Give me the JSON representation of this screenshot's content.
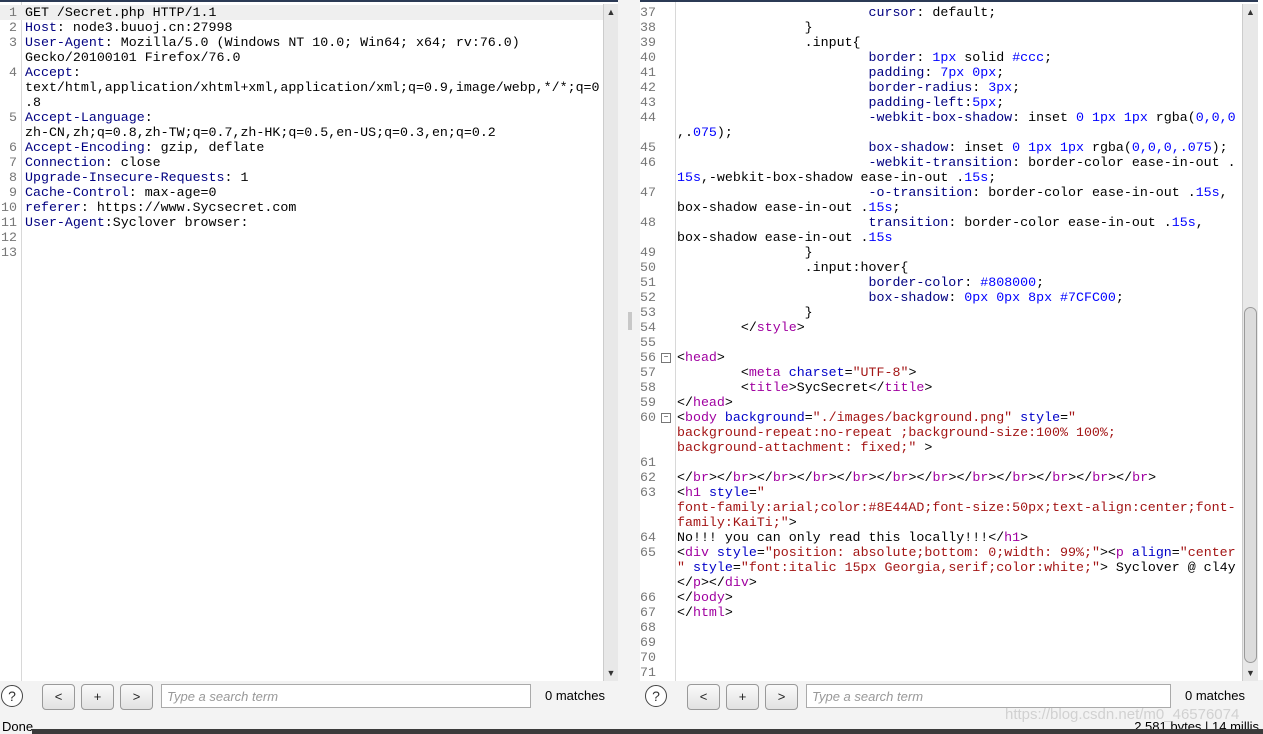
{
  "request": {
    "rows": [
      {
        "n": "1",
        "hl": true,
        "seg": [
          [
            "",
            "GET /Secret.php HTTP/1.1"
          ]
        ]
      },
      {
        "n": "2",
        "seg": [
          [
            "h",
            "Host"
          ],
          [
            "",
            ": node3.buuoj.cn:27998"
          ]
        ]
      },
      {
        "n": "3",
        "seg": [
          [
            "h",
            "User-Agent"
          ],
          [
            "",
            ": Mozilla/5.0 (Windows NT 10.0; Win64; x64; rv:76.0)"
          ]
        ]
      },
      {
        "n": "",
        "seg": [
          [
            "",
            "Gecko/20100101 Firefox/76.0"
          ]
        ]
      },
      {
        "n": "4",
        "seg": [
          [
            "h",
            "Accept"
          ],
          [
            "",
            ":"
          ]
        ]
      },
      {
        "n": "",
        "seg": [
          [
            "",
            "text/html,application/xhtml+xml,application/xml;q=0.9,image/webp,*/*;q=0"
          ]
        ]
      },
      {
        "n": "",
        "seg": [
          [
            "",
            ".8"
          ]
        ]
      },
      {
        "n": "5",
        "seg": [
          [
            "h",
            "Accept-Language"
          ],
          [
            "",
            ":"
          ]
        ]
      },
      {
        "n": "",
        "seg": [
          [
            "",
            "zh-CN,zh;q=0.8,zh-TW;q=0.7,zh-HK;q=0.5,en-US;q=0.3,en;q=0.2"
          ]
        ]
      },
      {
        "n": "6",
        "seg": [
          [
            "h",
            "Accept-Encoding"
          ],
          [
            "",
            ": gzip, deflate"
          ]
        ]
      },
      {
        "n": "7",
        "seg": [
          [
            "h",
            "Connection"
          ],
          [
            "",
            ": close"
          ]
        ]
      },
      {
        "n": "8",
        "seg": [
          [
            "h",
            "Upgrade-Insecure-Requests"
          ],
          [
            "",
            ": 1"
          ]
        ]
      },
      {
        "n": "9",
        "seg": [
          [
            "h",
            "Cache-Control"
          ],
          [
            "",
            ": max-age=0"
          ]
        ]
      },
      {
        "n": "10",
        "seg": [
          [
            "h",
            "referer"
          ],
          [
            "",
            ": https://www.Sycsecret.com"
          ]
        ]
      },
      {
        "n": "11",
        "seg": [
          [
            "h",
            "User-Agent"
          ],
          [
            "",
            ":Syclover browser:"
          ]
        ]
      },
      {
        "n": "12",
        "seg": []
      },
      {
        "n": "13",
        "seg": []
      }
    ]
  },
  "response": {
    "rows": [
      {
        "n": "37",
        "seg": [
          [
            "",
            "                        "
          ],
          [
            "p",
            "cursor"
          ],
          [
            "",
            ": default;"
          ]
        ]
      },
      {
        "n": "38",
        "seg": [
          [
            "",
            "                }"
          ]
        ]
      },
      {
        "n": "39",
        "seg": [
          [
            "",
            "                .input{"
          ]
        ]
      },
      {
        "n": "40",
        "seg": [
          [
            "",
            "                        "
          ],
          [
            "p",
            "border"
          ],
          [
            "",
            ": "
          ],
          [
            "v",
            "1px"
          ],
          [
            "",
            " solid "
          ],
          [
            "v",
            "#ccc"
          ],
          [
            "",
            ";"
          ]
        ]
      },
      {
        "n": "41",
        "seg": [
          [
            "",
            "                        "
          ],
          [
            "p",
            "padding"
          ],
          [
            "",
            ": "
          ],
          [
            "v",
            "7px 0px"
          ],
          [
            "",
            ";"
          ]
        ]
      },
      {
        "n": "42",
        "seg": [
          [
            "",
            "                        "
          ],
          [
            "p",
            "border-radius"
          ],
          [
            "",
            ": "
          ],
          [
            "v",
            "3px"
          ],
          [
            "",
            ";"
          ]
        ]
      },
      {
        "n": "43",
        "seg": [
          [
            "",
            "                        "
          ],
          [
            "p",
            "padding-left"
          ],
          [
            "",
            ":"
          ],
          [
            "v",
            "5px"
          ],
          [
            "",
            ";"
          ]
        ]
      },
      {
        "n": "44",
        "seg": [
          [
            "",
            "                        "
          ],
          [
            "p",
            "-webkit-box-shadow"
          ],
          [
            "",
            ": inset "
          ],
          [
            "v",
            "0 1px 1px"
          ],
          [
            "",
            " rgba("
          ],
          [
            "v",
            "0,0,0"
          ]
        ]
      },
      {
        "n": "",
        "seg": [
          [
            "",
            ",."
          ],
          [
            "v",
            "075"
          ],
          [
            "",
            ");"
          ]
        ]
      },
      {
        "n": "45",
        "seg": [
          [
            "",
            "                        "
          ],
          [
            "p",
            "box-shadow"
          ],
          [
            "",
            ": inset "
          ],
          [
            "v",
            "0 1px 1px"
          ],
          [
            "",
            " rgba("
          ],
          [
            "v",
            "0,0,0,.075"
          ],
          [
            "",
            ");"
          ]
        ]
      },
      {
        "n": "46",
        "seg": [
          [
            "",
            "                        "
          ],
          [
            "p",
            "-webkit-transition"
          ],
          [
            "",
            ": border-color ease-in-out ."
          ]
        ]
      },
      {
        "n": "",
        "seg": [
          [
            "v",
            "15s"
          ],
          [
            "",
            ",-webkit-box-shadow ease-in-out ."
          ],
          [
            "v",
            "15s"
          ],
          [
            "",
            ";"
          ]
        ]
      },
      {
        "n": "47",
        "seg": [
          [
            "",
            "                        "
          ],
          [
            "p",
            "-o-transition"
          ],
          [
            "",
            ": border-color ease-in-out ."
          ],
          [
            "v",
            "15s"
          ],
          [
            "",
            ","
          ]
        ]
      },
      {
        "n": "",
        "seg": [
          [
            "",
            "box-shadow ease-in-out ."
          ],
          [
            "v",
            "15s"
          ],
          [
            "",
            ";"
          ]
        ]
      },
      {
        "n": "48",
        "seg": [
          [
            "",
            "                        "
          ],
          [
            "p",
            "transition"
          ],
          [
            "",
            ": border-color ease-in-out ."
          ],
          [
            "v",
            "15s"
          ],
          [
            "",
            ","
          ]
        ]
      },
      {
        "n": "",
        "seg": [
          [
            "",
            "box-shadow ease-in-out ."
          ],
          [
            "v",
            "15s"
          ]
        ]
      },
      {
        "n": "49",
        "seg": [
          [
            "",
            "                }"
          ]
        ]
      },
      {
        "n": "50",
        "seg": [
          [
            "",
            "                .input:hover{"
          ]
        ]
      },
      {
        "n": "51",
        "seg": [
          [
            "",
            "                        "
          ],
          [
            "p",
            "border-color"
          ],
          [
            "",
            ": "
          ],
          [
            "v",
            "#808000"
          ],
          [
            "",
            ";"
          ]
        ]
      },
      {
        "n": "52",
        "seg": [
          [
            "",
            "                        "
          ],
          [
            "p",
            "box-shadow"
          ],
          [
            "",
            ": "
          ],
          [
            "v",
            "0px 0px 8px #7CFC00"
          ],
          [
            "",
            ";"
          ]
        ]
      },
      {
        "n": "53",
        "seg": [
          [
            "",
            "                }"
          ]
        ]
      },
      {
        "n": "54",
        "seg": [
          [
            "",
            "        </"
          ],
          [
            "t",
            "style"
          ],
          [
            "",
            ">"
          ]
        ]
      },
      {
        "n": "55",
        "seg": []
      },
      {
        "n": "56",
        "fold": true,
        "seg": [
          [
            "",
            "<"
          ],
          [
            "t",
            "head"
          ],
          [
            "",
            ">"
          ]
        ]
      },
      {
        "n": "57",
        "seg": [
          [
            "",
            "        <"
          ],
          [
            "t",
            "meta"
          ],
          [
            "",
            " "
          ],
          [
            "a",
            "charset"
          ],
          [
            "",
            "="
          ],
          [
            "s",
            "\"UTF-8\""
          ],
          [
            "",
            ">"
          ]
        ]
      },
      {
        "n": "58",
        "seg": [
          [
            "",
            "        <"
          ],
          [
            "t",
            "title"
          ],
          [
            "",
            ">SycSecret</"
          ],
          [
            "t",
            "title"
          ],
          [
            "",
            ">"
          ]
        ]
      },
      {
        "n": "59",
        "seg": [
          [
            "",
            "</"
          ],
          [
            "t",
            "head"
          ],
          [
            "",
            ">"
          ]
        ]
      },
      {
        "n": "60",
        "fold": true,
        "seg": [
          [
            "",
            "<"
          ],
          [
            "t",
            "body"
          ],
          [
            "",
            " "
          ],
          [
            "a",
            "background"
          ],
          [
            "",
            "="
          ],
          [
            "s",
            "\"./images/background.png\""
          ],
          [
            "",
            " "
          ],
          [
            "a",
            "style"
          ],
          [
            "",
            "="
          ],
          [
            "s",
            "\""
          ]
        ]
      },
      {
        "n": "",
        "seg": [
          [
            "s",
            "background-repeat:no-repeat ;background-size:100% 100%;"
          ]
        ]
      },
      {
        "n": "",
        "seg": [
          [
            "s",
            "background-attachment: fixed;\""
          ],
          [
            "",
            " >"
          ]
        ]
      },
      {
        "n": "61",
        "seg": []
      },
      {
        "n": "62",
        "seg": [
          [
            "",
            "</"
          ],
          [
            "t",
            "br"
          ],
          [
            "",
            "></"
          ],
          [
            "t",
            "br"
          ],
          [
            "",
            "></"
          ],
          [
            "t",
            "br"
          ],
          [
            "",
            "></"
          ],
          [
            "t",
            "br"
          ],
          [
            "",
            "></"
          ],
          [
            "t",
            "br"
          ],
          [
            "",
            "></"
          ],
          [
            "t",
            "br"
          ],
          [
            "",
            "></"
          ],
          [
            "t",
            "br"
          ],
          [
            "",
            "></"
          ],
          [
            "t",
            "br"
          ],
          [
            "",
            "></"
          ],
          [
            "t",
            "br"
          ],
          [
            "",
            "></"
          ],
          [
            "t",
            "br"
          ],
          [
            "",
            "></"
          ],
          [
            "t",
            "br"
          ],
          [
            "",
            "></"
          ],
          [
            "t",
            "br"
          ],
          [
            "",
            ">"
          ]
        ]
      },
      {
        "n": "63",
        "seg": [
          [
            "",
            "<"
          ],
          [
            "t",
            "h1"
          ],
          [
            "",
            " "
          ],
          [
            "a",
            "style"
          ],
          [
            "",
            "="
          ],
          [
            "s",
            "\""
          ]
        ]
      },
      {
        "n": "",
        "seg": [
          [
            "s",
            "font-family:arial;color:#8E44AD;font-size:50px;text-align:center;font-"
          ]
        ]
      },
      {
        "n": "",
        "seg": [
          [
            "s",
            "family:KaiTi;\""
          ],
          [
            "",
            ">"
          ]
        ]
      },
      {
        "n": "64",
        "seg": [
          [
            "",
            "No!!! you can only read this locally!!!</"
          ],
          [
            "t",
            "h1"
          ],
          [
            "",
            ">"
          ]
        ]
      },
      {
        "n": "65",
        "seg": [
          [
            "",
            "<"
          ],
          [
            "t",
            "div"
          ],
          [
            "",
            " "
          ],
          [
            "a",
            "style"
          ],
          [
            "",
            "="
          ],
          [
            "s",
            "\"position: absolute;bottom: 0;width: 99%;\""
          ],
          [
            "",
            "><"
          ],
          [
            "t",
            "p"
          ],
          [
            "",
            " "
          ],
          [
            "a",
            "align"
          ],
          [
            "",
            "="
          ],
          [
            "s",
            "\"center"
          ]
        ]
      },
      {
        "n": "",
        "seg": [
          [
            "s",
            "\""
          ],
          [
            "",
            " "
          ],
          [
            "a",
            "style"
          ],
          [
            "",
            "="
          ],
          [
            "s",
            "\"font:italic 15px Georgia,serif;color:white;\""
          ],
          [
            "",
            "> Syclover @ cl4y"
          ]
        ]
      },
      {
        "n": "",
        "seg": [
          [
            "",
            "</"
          ],
          [
            "t",
            "p"
          ],
          [
            "",
            "></"
          ],
          [
            "t",
            "div"
          ],
          [
            "",
            ">"
          ]
        ]
      },
      {
        "n": "66",
        "seg": [
          [
            "",
            "</"
          ],
          [
            "t",
            "body"
          ],
          [
            "",
            ">"
          ]
        ]
      },
      {
        "n": "67",
        "seg": [
          [
            "",
            "</"
          ],
          [
            "t",
            "html"
          ],
          [
            "",
            ">"
          ]
        ]
      },
      {
        "n": "68",
        "seg": []
      },
      {
        "n": "69",
        "seg": []
      },
      {
        "n": "70",
        "seg": []
      },
      {
        "n": "71",
        "seg": []
      }
    ]
  },
  "search": {
    "help": "?",
    "prev": "<",
    "add": "+",
    "next": ">",
    "placeholder": "Type a search term",
    "matches": "0 matches"
  },
  "status": {
    "left": "Done",
    "right": "2,581 bytes | 14 millis"
  },
  "watermark": "https://blog.csdn.net/m0_46576074",
  "icons": {
    "scroll_up": "triangle-up",
    "scroll_down": "triangle-down",
    "fold": "minus-box",
    "help": "question-circle"
  },
  "colors": {
    "header_name": "#000080",
    "number": "#0000ff",
    "tag": "#a000a0",
    "attr": "#0000c8",
    "string": "#a31515"
  }
}
